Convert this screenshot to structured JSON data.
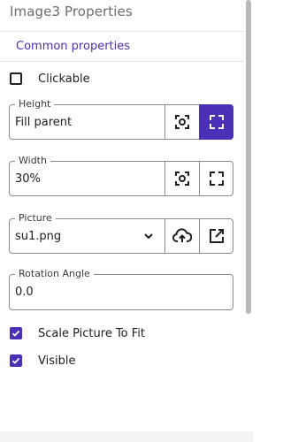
{
  "panel": {
    "title": "Image3 Properties",
    "section_header": "Common properties"
  },
  "checkboxes": {
    "clickable": {
      "label": "Clickable",
      "checked": false
    },
    "scale_picture": {
      "label": "Scale Picture To Fit",
      "checked": true
    },
    "visible": {
      "label": "Visible",
      "checked": true
    }
  },
  "height_field": {
    "legend": "Height",
    "value": "Fill parent",
    "buttons": [
      {
        "icon": "fit-content-icon",
        "active": false
      },
      {
        "icon": "fill-parent-icon",
        "active": true
      }
    ]
  },
  "width_field": {
    "legend": "Width",
    "value": "30%",
    "buttons": [
      {
        "icon": "fit-content-icon",
        "active": false
      },
      {
        "icon": "fill-parent-icon",
        "active": false
      }
    ]
  },
  "picture_field": {
    "legend": "Picture",
    "value": "su1.png",
    "buttons": [
      {
        "icon": "cloud-upload-icon"
      },
      {
        "icon": "open-external-icon"
      }
    ]
  },
  "rotation_field": {
    "legend": "Rotation Angle",
    "value": "0.0"
  },
  "colors": {
    "accent": "#4b2fb6",
    "border": "#8a8a8a",
    "title_text": "#6c6c6c"
  }
}
